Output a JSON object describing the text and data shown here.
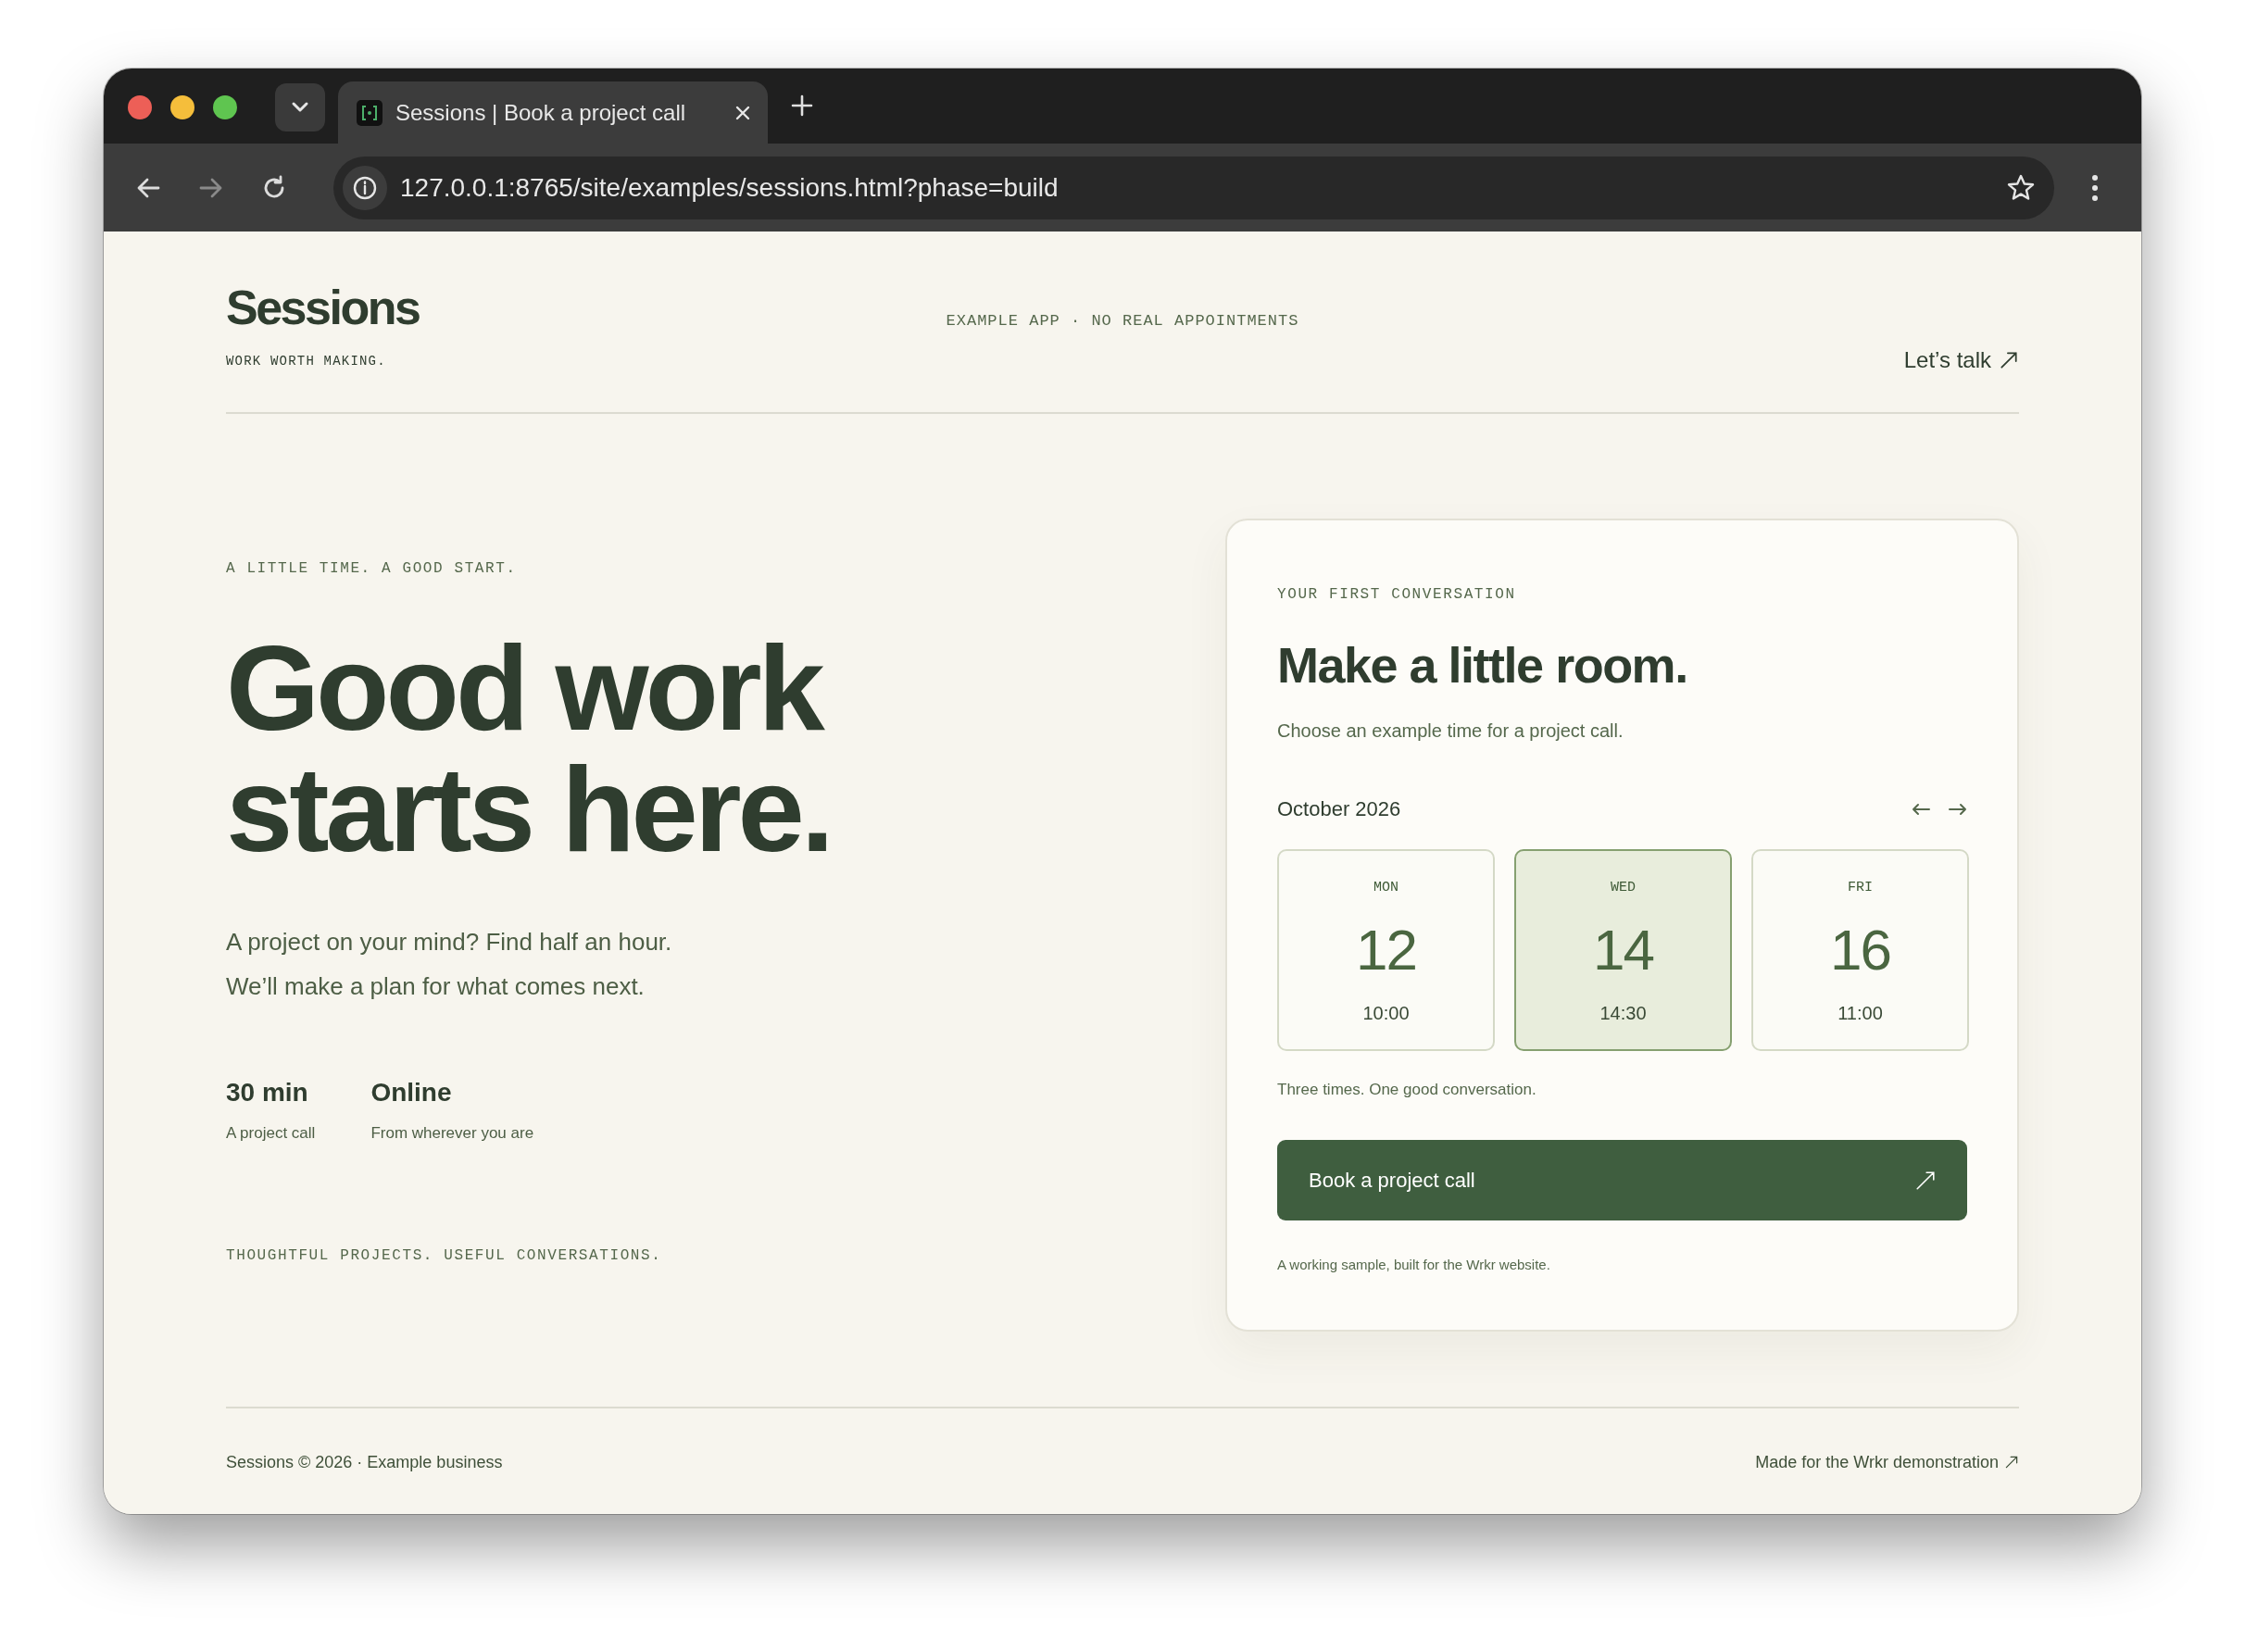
{
  "browser": {
    "tab_title": "Sessions | Book a project call",
    "url": "127.0.0.1:8765/site/examples/sessions.html?phase=build"
  },
  "header": {
    "logo": "Sessions",
    "tagline": "WORK WORTH MAKING.",
    "notice": "EXAMPLE APP · NO REAL APPOINTMENTS",
    "cta": "Let’s talk"
  },
  "hero": {
    "eyebrow": "A LITTLE TIME. A GOOD START.",
    "headline": [
      "Good work",
      "starts here."
    ],
    "intro": [
      "A project on your mind? Find half an hour.",
      "We’ll make a plan for what comes next."
    ],
    "stats": [
      {
        "value": "30 min",
        "label": "A project call"
      },
      {
        "value": "Online",
        "label": "From wherever you are"
      }
    ],
    "closing": "THOUGHTFUL PROJECTS. USEFUL CONVERSATIONS."
  },
  "booking": {
    "eyebrow": "YOUR FIRST CONVERSATION",
    "title": "Make a little room.",
    "subtitle": "Choose an example time for a project call.",
    "month": "October 2026",
    "days": [
      {
        "weekday": "MON",
        "day": "12",
        "time": "10:00",
        "selected": false
      },
      {
        "weekday": "WED",
        "day": "14",
        "time": "14:30",
        "selected": true
      },
      {
        "weekday": "FRI",
        "day": "16",
        "time": "11:00",
        "selected": false
      }
    ],
    "caption": "Three times. One good conversation.",
    "button": "Book a project call",
    "note": "A working sample, built for the Wrkr website."
  },
  "footer": {
    "copyright": "Sessions © 2026 · Example business",
    "link": "Made for the Wrkr demonstration"
  }
}
